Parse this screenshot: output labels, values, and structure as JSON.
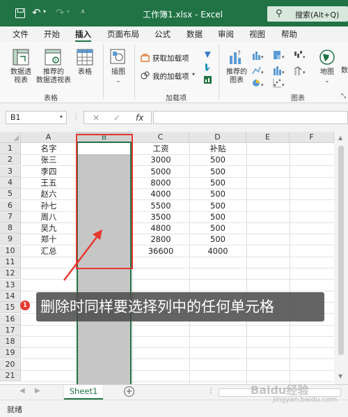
{
  "window": {
    "title": "工作簿1.xlsx  -  Excel",
    "search_placeholder": "搜索(Alt+Q)"
  },
  "tabs": [
    "文件",
    "开始",
    "插入",
    "页面布局",
    "公式",
    "数据",
    "审阅",
    "视图",
    "帮助"
  ],
  "active_tab": "插入",
  "ribbon": {
    "pivot_label_1": "数据透",
    "pivot_label_2": "视表",
    "rec_pivot_label_1": "推荐的",
    "rec_pivot_label_2": "数据透视表",
    "table_label": "表格",
    "group_tables": "表格",
    "illustrations_label": "插图",
    "get_addins": "获取加载项",
    "my_addins": "我的加载项",
    "group_addins": "加载项",
    "rec_charts_1": "推荐的",
    "rec_charts_2": "图表",
    "group_charts": "图表",
    "map_label": "地图"
  },
  "formula_bar": {
    "name_box": "B1",
    "cancel": "✕",
    "confirm": "✓",
    "fx": "fx",
    "formula": ""
  },
  "columns": [
    "A",
    "B",
    "C",
    "D",
    "E",
    "F"
  ],
  "rows": [
    "1",
    "2",
    "3",
    "4",
    "5",
    "6",
    "7",
    "8",
    "9",
    "10",
    "11",
    "12",
    "13",
    "14",
    "15",
    "16",
    "17",
    "18",
    "19",
    "20",
    "21"
  ],
  "table": {
    "headers": {
      "a": "名字",
      "c": "工资",
      "d": "补贴"
    },
    "records": [
      {
        "name": "张三",
        "salary": "3000",
        "allowance": "500"
      },
      {
        "name": "李四",
        "salary": "5000",
        "allowance": "500"
      },
      {
        "name": "王五",
        "salary": "8000",
        "allowance": "500"
      },
      {
        "name": "赵六",
        "salary": "4000",
        "allowance": "500"
      },
      {
        "name": "孙七",
        "salary": "5500",
        "allowance": "500"
      },
      {
        "name": "周八",
        "salary": "3500",
        "allowance": "500"
      },
      {
        "name": "吴九",
        "salary": "4800",
        "allowance": "500"
      },
      {
        "name": "郑十",
        "salary": "2800",
        "allowance": "500"
      },
      {
        "name": "汇总",
        "salary": "36600",
        "allowance": "4000"
      }
    ]
  },
  "annotation": {
    "badge": "1",
    "text": "删除时同样要选择列中的任何单元格"
  },
  "sheet_tab": "Sheet1",
  "add_sheet": "+",
  "status": "就绪",
  "watermark": "Baidu经验",
  "watermark_sub": "jingyan.baidu.com",
  "colors": {
    "excel_green": "#217346",
    "selection_gray": "#c6c6c6",
    "annotation_red": "#e8382f"
  }
}
